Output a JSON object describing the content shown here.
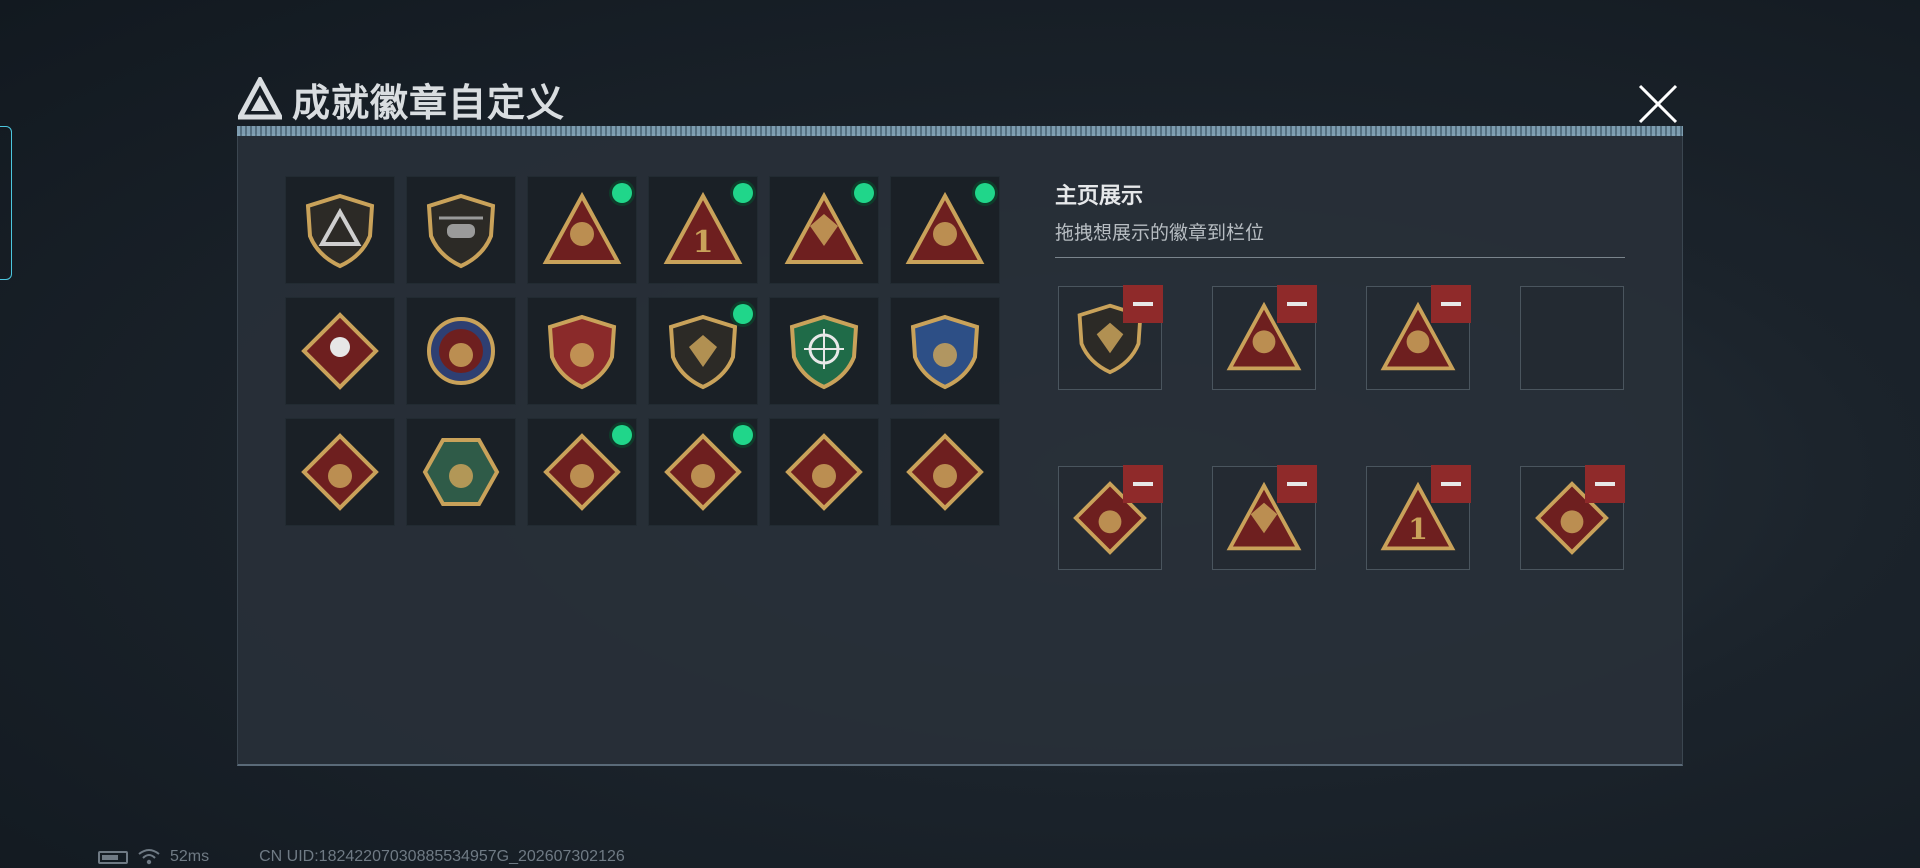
{
  "dialog": {
    "title": "成就徽章自定义",
    "title_icon": "triangle-logo-icon",
    "close_icon": "close-icon"
  },
  "badge_grid": {
    "badges": [
      {
        "icon": "triangle-shield-badge-icon",
        "selected": false
      },
      {
        "icon": "helicopter-shield-badge-icon",
        "selected": false
      },
      {
        "icon": "tower-triangle-badge-icon",
        "selected": true
      },
      {
        "icon": "number-one-triangle-badge-icon",
        "selected": true
      },
      {
        "icon": "hands-gem-triangle-badge-icon",
        "selected": true
      },
      {
        "icon": "soldiers-triangle-badge-icon",
        "selected": true
      },
      {
        "icon": "rose-diamond-badge-icon",
        "selected": false
      },
      {
        "icon": "star-medal-badge-icon",
        "selected": false
      },
      {
        "icon": "laurel-shield-badge-icon",
        "selected": false
      },
      {
        "icon": "gem-shield-badge-icon",
        "selected": true
      },
      {
        "icon": "crosshair-green-shield-badge-icon",
        "selected": false
      },
      {
        "icon": "crossed-arms-blue-shield-badge-icon",
        "selected": false
      },
      {
        "icon": "wolf-diamond-badge-icon",
        "selected": false
      },
      {
        "icon": "hornet-hexagon-badge-icon",
        "selected": false
      },
      {
        "icon": "dragon-diamond-badge-icon",
        "selected": true
      },
      {
        "icon": "runner-diamond-badge-icon",
        "selected": true
      },
      {
        "icon": "horse-diamond-badge-icon",
        "selected": false
      },
      {
        "icon": "wrench-diamond-badge-icon",
        "selected": false
      }
    ]
  },
  "homepage_display": {
    "title": "主页展示",
    "subtitle": "拖拽想展示的徽章到栏位",
    "slots": [
      {
        "icon": "gem-shield-badge-icon",
        "filled": true
      },
      {
        "icon": "soldiers-triangle-badge-icon",
        "filled": true
      },
      {
        "icon": "tower-triangle-badge-icon",
        "filled": true
      },
      {
        "icon": "",
        "filled": false
      },
      {
        "icon": "dragon-diamond-badge-icon",
        "filled": true
      },
      {
        "icon": "hands-gem-triangle-badge-icon",
        "filled": true
      },
      {
        "icon": "number-one-triangle-badge-icon",
        "filled": true
      },
      {
        "icon": "runner-diamond-badge-icon",
        "filled": true
      }
    ]
  },
  "status_bar": {
    "latency": "52ms",
    "uid": "CN UID:18242207030885534957G_202607302126",
    "battery_icon": "battery-icon",
    "wifi_icon": "wifi-icon"
  },
  "colors": {
    "accent_green": "#20d68a",
    "remove_red": "#8f2a2a",
    "gold": "#c9a25a",
    "badge_red": "#6e1f1f"
  }
}
